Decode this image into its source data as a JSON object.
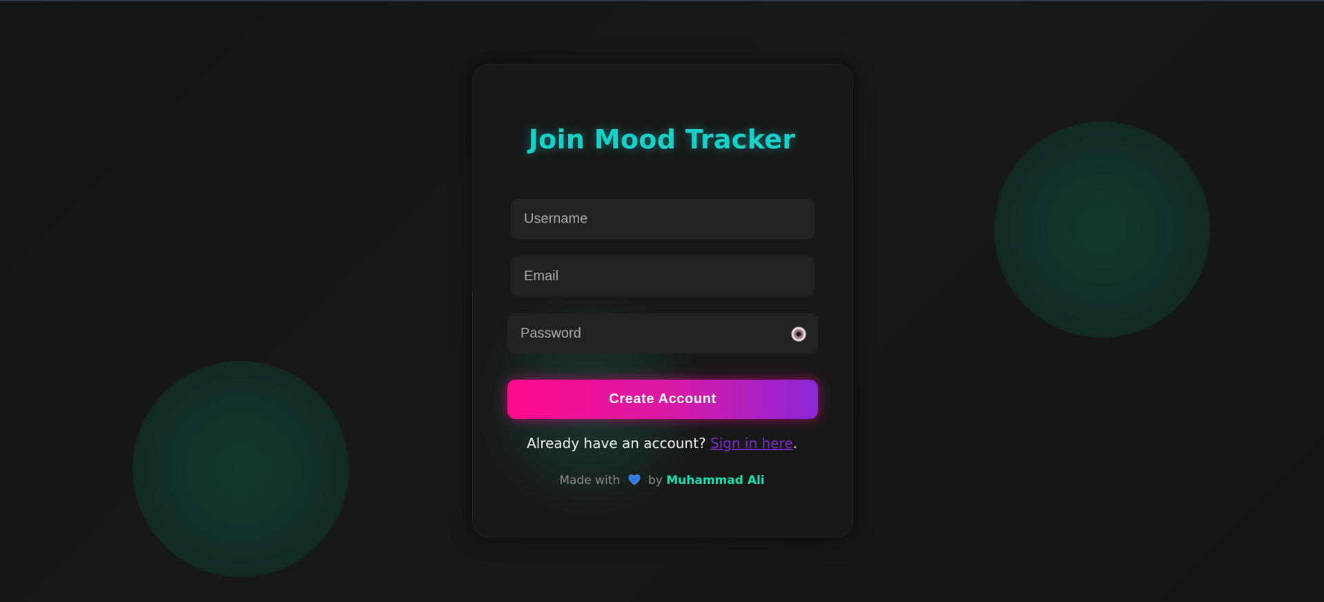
{
  "title": "Join Mood Tracker",
  "form": {
    "username_placeholder": "Username",
    "email_placeholder": "Email",
    "password_placeholder": "Password",
    "password_toggle_icon": "eye-icon",
    "submit_label": "Create Account"
  },
  "signin": {
    "prompt": "Already have an account?",
    "link_text": "Sign in here",
    "punctuation": "."
  },
  "footer": {
    "made_with": "Made with",
    "by": "by",
    "author": "Muhammad Ali",
    "heart_icon": "heart-icon"
  },
  "colors": {
    "title": "#19d1c8",
    "button_start": "#ff0a8c",
    "button_end": "#8a27d6",
    "link": "#7a2cc7",
    "author": "#16e3b0"
  }
}
